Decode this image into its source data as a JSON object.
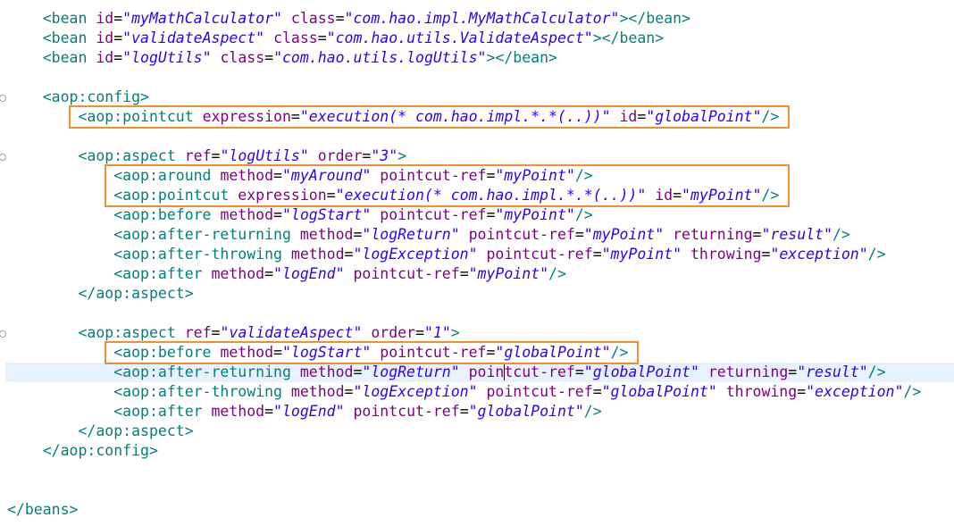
{
  "editor": {
    "lines": [
      {
        "indent": "    ",
        "parts": [
          [
            "t",
            "<bean "
          ],
          [
            "a",
            "id"
          ],
          [
            "p",
            "="
          ],
          [
            "v",
            "\"myMathCalculator\""
          ],
          [
            "t",
            " "
          ],
          [
            "a",
            "class"
          ],
          [
            "p",
            "="
          ],
          [
            "v",
            "\"com.hao.impl.MyMathCalculator\""
          ],
          [
            "t",
            "></bean>"
          ]
        ]
      },
      {
        "indent": "    ",
        "parts": [
          [
            "t",
            "<bean "
          ],
          [
            "a",
            "id"
          ],
          [
            "p",
            "="
          ],
          [
            "v",
            "\"validateAspect\""
          ],
          [
            "t",
            " "
          ],
          [
            "a",
            "class"
          ],
          [
            "p",
            "="
          ],
          [
            "v",
            "\"com.hao.utils.ValidateAspect\""
          ],
          [
            "t",
            "></bean>"
          ]
        ]
      },
      {
        "indent": "    ",
        "parts": [
          [
            "t",
            "<bean "
          ],
          [
            "a",
            "id"
          ],
          [
            "p",
            "="
          ],
          [
            "v",
            "\"logUtils\""
          ],
          [
            "t",
            " "
          ],
          [
            "a",
            "class"
          ],
          [
            "p",
            "="
          ],
          [
            "v",
            "\"com.hao.utils.logUtils\""
          ],
          [
            "t",
            "></bean>"
          ]
        ]
      },
      {
        "indent": "",
        "parts": []
      },
      {
        "indent": "    ",
        "parts": [
          [
            "t",
            "<aop:config>"
          ]
        ]
      },
      {
        "indent": "        ",
        "parts": [
          [
            "t",
            "<aop:pointcut "
          ],
          [
            "a",
            "expression"
          ],
          [
            "p",
            "="
          ],
          [
            "v",
            "\"execution(* com.hao.impl.*.*(..))\""
          ],
          [
            "t",
            " "
          ],
          [
            "a",
            "id"
          ],
          [
            "p",
            "="
          ],
          [
            "v",
            "\"globalPoint\""
          ],
          [
            "t",
            "/>"
          ]
        ]
      },
      {
        "indent": "",
        "parts": []
      },
      {
        "indent": "        ",
        "parts": [
          [
            "t",
            "<aop:aspect "
          ],
          [
            "a",
            "ref"
          ],
          [
            "p",
            "="
          ],
          [
            "v",
            "\"logUtils\""
          ],
          [
            "t",
            " "
          ],
          [
            "a",
            "order"
          ],
          [
            "p",
            "="
          ],
          [
            "v",
            "\"3\""
          ],
          [
            "t",
            ">"
          ]
        ]
      },
      {
        "indent": "            ",
        "parts": [
          [
            "t",
            "<aop:around "
          ],
          [
            "a",
            "method"
          ],
          [
            "p",
            "="
          ],
          [
            "v",
            "\"myAround\""
          ],
          [
            "t",
            " "
          ],
          [
            "a",
            "pointcut-ref"
          ],
          [
            "p",
            "="
          ],
          [
            "v",
            "\"myPoint\""
          ],
          [
            "t",
            "/>"
          ]
        ]
      },
      {
        "indent": "            ",
        "parts": [
          [
            "t",
            "<aop:pointcut "
          ],
          [
            "a",
            "expression"
          ],
          [
            "p",
            "="
          ],
          [
            "v",
            "\"execution(* com.hao.impl.*.*(..))\""
          ],
          [
            "t",
            " "
          ],
          [
            "a",
            "id"
          ],
          [
            "p",
            "="
          ],
          [
            "v",
            "\"myPoint\""
          ],
          [
            "t",
            "/>"
          ]
        ]
      },
      {
        "indent": "            ",
        "parts": [
          [
            "t",
            "<aop:before "
          ],
          [
            "a",
            "method"
          ],
          [
            "p",
            "="
          ],
          [
            "v",
            "\"logStart\""
          ],
          [
            "t",
            " "
          ],
          [
            "a",
            "pointcut-ref"
          ],
          [
            "p",
            "="
          ],
          [
            "v",
            "\"myPoint\""
          ],
          [
            "t",
            "/>"
          ]
        ]
      },
      {
        "indent": "            ",
        "parts": [
          [
            "t",
            "<aop:after-returning "
          ],
          [
            "a",
            "method"
          ],
          [
            "p",
            "="
          ],
          [
            "v",
            "\"logReturn\""
          ],
          [
            "t",
            " "
          ],
          [
            "a",
            "pointcut-ref"
          ],
          [
            "p",
            "="
          ],
          [
            "v",
            "\"myPoint\""
          ],
          [
            "t",
            " "
          ],
          [
            "a",
            "returning"
          ],
          [
            "p",
            "="
          ],
          [
            "v",
            "\"result\""
          ],
          [
            "t",
            "/>"
          ]
        ]
      },
      {
        "indent": "            ",
        "parts": [
          [
            "t",
            "<aop:after-throwing "
          ],
          [
            "a",
            "method"
          ],
          [
            "p",
            "="
          ],
          [
            "v",
            "\"logException\""
          ],
          [
            "t",
            " "
          ],
          [
            "a",
            "pointcut-ref"
          ],
          [
            "p",
            "="
          ],
          [
            "v",
            "\"myPoint\""
          ],
          [
            "t",
            " "
          ],
          [
            "a",
            "throwing"
          ],
          [
            "p",
            "="
          ],
          [
            "v",
            "\"exception\""
          ],
          [
            "t",
            "/>"
          ]
        ]
      },
      {
        "indent": "            ",
        "parts": [
          [
            "t",
            "<aop:after "
          ],
          [
            "a",
            "method"
          ],
          [
            "p",
            "="
          ],
          [
            "v",
            "\"logEnd\""
          ],
          [
            "t",
            " "
          ],
          [
            "a",
            "pointcut-ref"
          ],
          [
            "p",
            "="
          ],
          [
            "v",
            "\"myPoint\""
          ],
          [
            "t",
            "/>"
          ]
        ]
      },
      {
        "indent": "        ",
        "parts": [
          [
            "t",
            "</aop:aspect>"
          ]
        ]
      },
      {
        "indent": "",
        "parts": []
      },
      {
        "indent": "        ",
        "parts": [
          [
            "t",
            "<aop:aspect "
          ],
          [
            "a",
            "ref"
          ],
          [
            "p",
            "="
          ],
          [
            "v",
            "\"validateAspect\""
          ],
          [
            "t",
            " "
          ],
          [
            "a",
            "order"
          ],
          [
            "p",
            "="
          ],
          [
            "v",
            "\"1\""
          ],
          [
            "t",
            ">"
          ]
        ]
      },
      {
        "indent": "            ",
        "parts": [
          [
            "t",
            "<aop:before "
          ],
          [
            "a",
            "method"
          ],
          [
            "p",
            "="
          ],
          [
            "v",
            "\"logStart\""
          ],
          [
            "t",
            " "
          ],
          [
            "a",
            "pointcut-ref"
          ],
          [
            "p",
            "="
          ],
          [
            "v",
            "\"globalPoint\""
          ],
          [
            "t",
            "/>"
          ]
        ]
      },
      {
        "indent": "            ",
        "parts": [
          [
            "t",
            "<aop:after-returning "
          ],
          [
            "a",
            "method"
          ],
          [
            "p",
            "="
          ],
          [
            "v",
            "\"logReturn\""
          ],
          [
            "t",
            " "
          ],
          [
            "a",
            "pointcut-ref"
          ],
          [
            "p",
            "="
          ],
          [
            "v",
            "\"globalPoint\""
          ],
          [
            "t",
            " "
          ],
          [
            "a",
            "returning"
          ],
          [
            "p",
            "="
          ],
          [
            "v",
            "\"result\""
          ],
          [
            "t",
            "/>"
          ]
        ]
      },
      {
        "indent": "            ",
        "parts": [
          [
            "t",
            "<aop:after-throwing "
          ],
          [
            "a",
            "method"
          ],
          [
            "p",
            "="
          ],
          [
            "v",
            "\"logException\""
          ],
          [
            "t",
            " "
          ],
          [
            "a",
            "pointcut-ref"
          ],
          [
            "p",
            "="
          ],
          [
            "v",
            "\"globalPoint\""
          ],
          [
            "t",
            " "
          ],
          [
            "a",
            "throwing"
          ],
          [
            "p",
            "="
          ],
          [
            "v",
            "\"exception\""
          ],
          [
            "t",
            "/>"
          ]
        ]
      },
      {
        "indent": "            ",
        "parts": [
          [
            "t",
            "<aop:after "
          ],
          [
            "a",
            "method"
          ],
          [
            "p",
            "="
          ],
          [
            "v",
            "\"logEnd\""
          ],
          [
            "t",
            " "
          ],
          [
            "a",
            "pointcut-ref"
          ],
          [
            "p",
            "="
          ],
          [
            "v",
            "\"globalPoint\""
          ],
          [
            "t",
            "/>"
          ]
        ]
      },
      {
        "indent": "        ",
        "parts": [
          [
            "t",
            "</aop:aspect>"
          ]
        ]
      },
      {
        "indent": "    ",
        "parts": [
          [
            "t",
            "</aop:config>"
          ]
        ]
      },
      {
        "indent": "",
        "parts": []
      },
      {
        "indent": "",
        "parts": []
      },
      {
        "indent": "",
        "parts": [
          [
            "t",
            "</beans>"
          ]
        ]
      }
    ],
    "current_line": 18,
    "fold_markers": [
      4,
      7,
      16
    ],
    "highlighted_lines": [
      [
        5,
        5
      ],
      [
        8,
        9
      ],
      [
        17,
        17
      ]
    ],
    "highlight_color": "#f28f30",
    "colors": {
      "tag": "#008080",
      "attribute": "#7f007f",
      "value": "#2a00ff",
      "current_line_bg": "#e8f2fe"
    }
  }
}
